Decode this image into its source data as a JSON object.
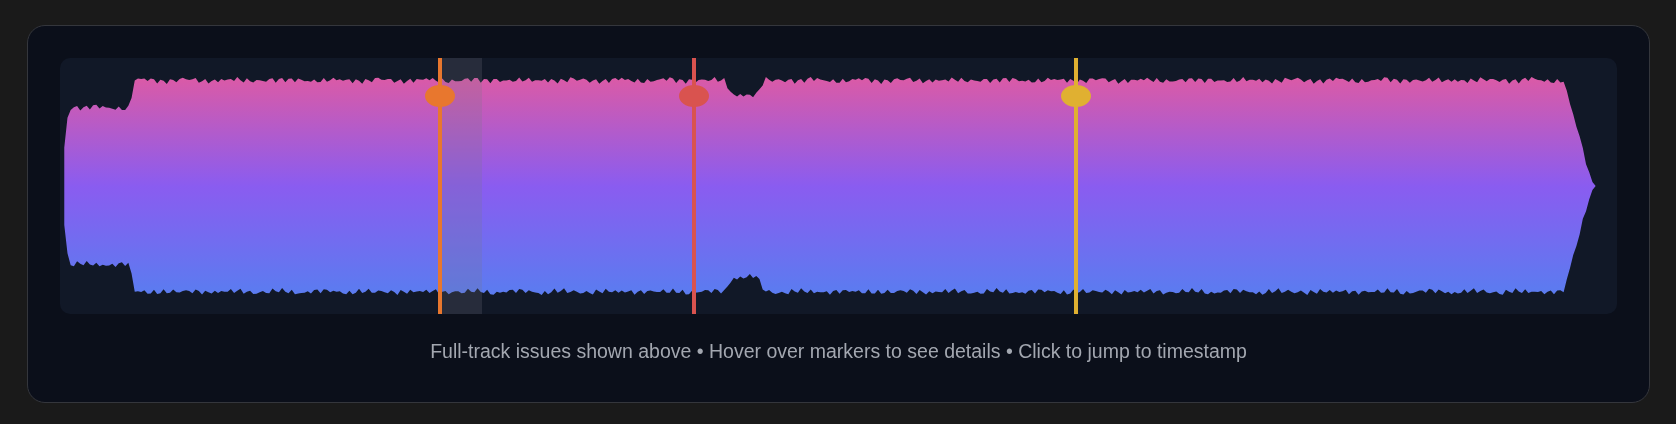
{
  "markers": [
    {
      "color": "#e8772e",
      "hovered": true
    },
    {
      "color": "#d9534f",
      "hovered": false
    },
    {
      "color": "#e0b031",
      "hovered": false
    }
  ],
  "caption": "Full-track issues shown above • Hover over markers to see details • Click to jump to timestamp"
}
